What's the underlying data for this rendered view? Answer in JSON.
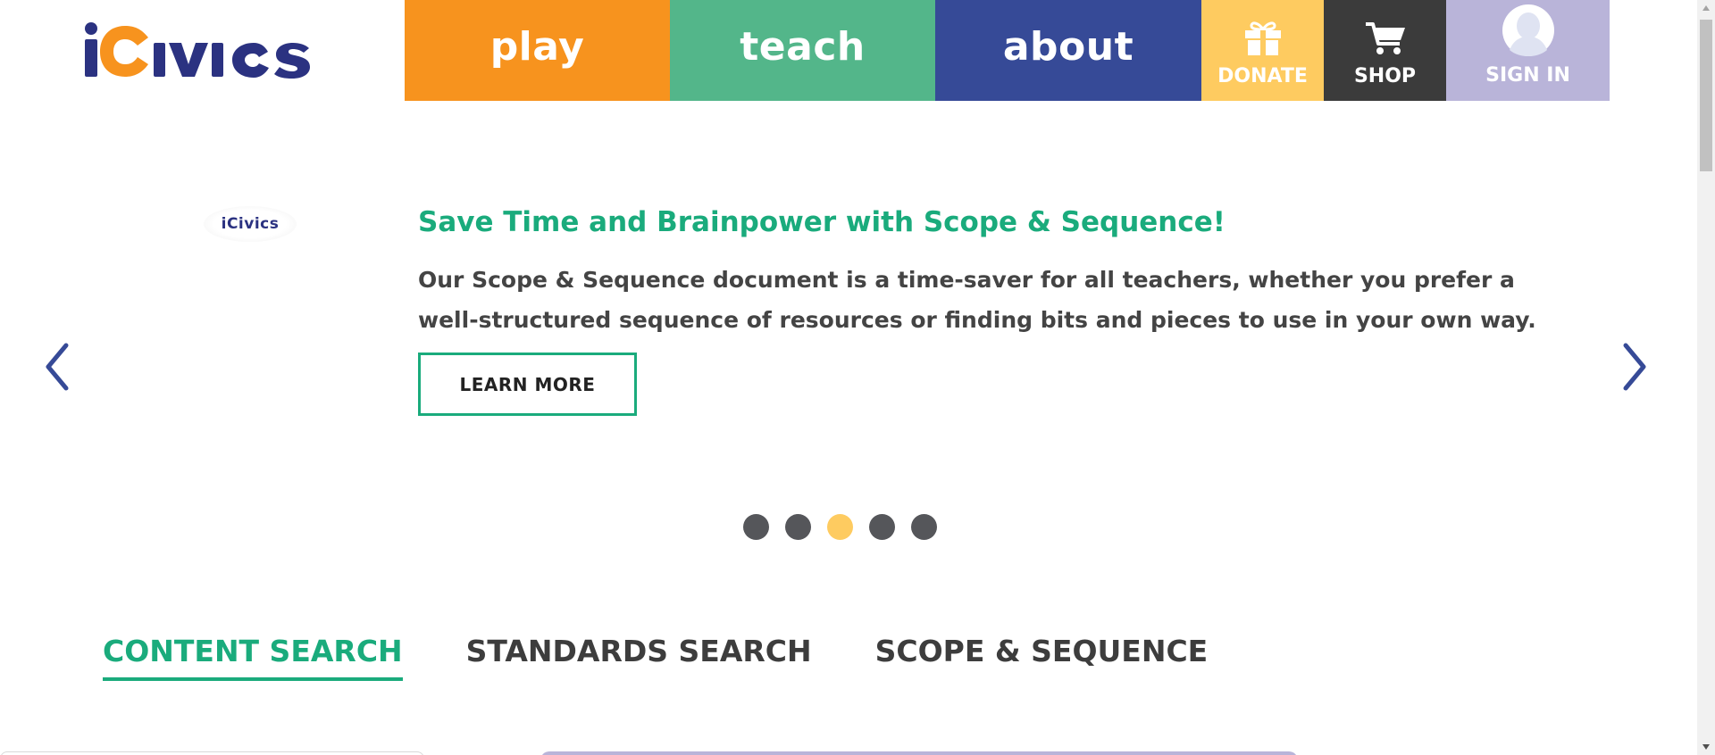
{
  "header": {
    "logo_text": "iCivics",
    "nav": [
      {
        "label": "play",
        "color": "#f7931e"
      },
      {
        "label": "teach",
        "color": "#53b68a"
      },
      {
        "label": "about",
        "color": "#364a97"
      }
    ],
    "utility": {
      "donate_label": "DONATE",
      "shop_label": "SHOP",
      "signin_label": "SIGN IN"
    }
  },
  "carousel": {
    "slide_logo_text": "iCivics",
    "title": "Save Time and Brainpower with Scope & Sequence!",
    "body": "Our Scope & Sequence document is a time-saver for all teachers, whether you prefer a well-structured sequence of resources or finding bits and pieces to use in your own way.",
    "cta_label": "LEARN MORE",
    "dots_count": 5,
    "active_dot": 3,
    "accent_color": "#1aab7c"
  },
  "search_tabs": [
    {
      "label": "CONTENT SEARCH",
      "active": true
    },
    {
      "label": "STANDARDS SEARCH",
      "active": false
    },
    {
      "label": "SCOPE & SEQUENCE",
      "active": false
    }
  ],
  "icons": {
    "prev": "chevron-left-icon",
    "next": "chevron-right-icon",
    "donate": "gift-icon",
    "shop": "cart-icon",
    "signin": "user-avatar-icon"
  }
}
